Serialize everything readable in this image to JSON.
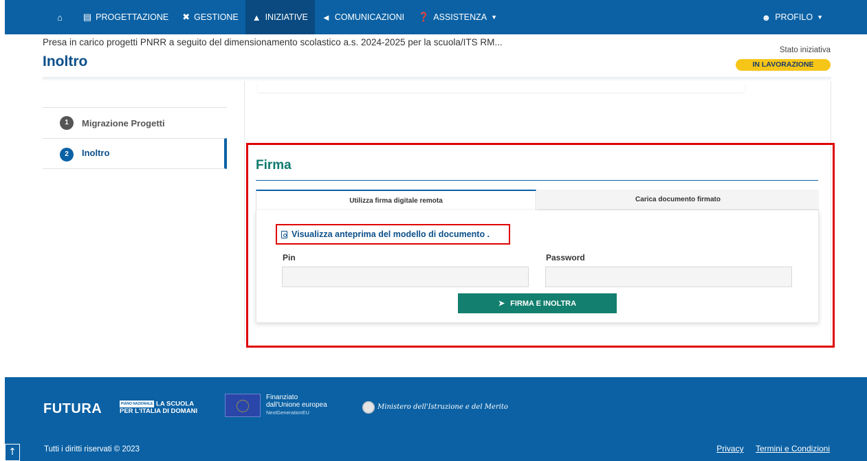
{
  "nav": {
    "items": [
      {
        "label": "PROGETTAZIONE",
        "icon": "clipboard-icon"
      },
      {
        "label": "GESTIONE",
        "icon": "tools-icon"
      },
      {
        "label": "INIZIATIVE",
        "icon": "rocket-icon"
      },
      {
        "label": "COMUNICAZIONI",
        "icon": "megaphone-icon"
      },
      {
        "label": "ASSISTENZA",
        "icon": "question-icon"
      }
    ],
    "profile": "PROFILO"
  },
  "header": {
    "subtitle": "Presa in carico progetti PNRR a seguito del dimensionamento scolastico a.s. 2024-2025 per la scuola/ITS RM...",
    "title": "Inoltro",
    "stato_label": "Stato iniziativa",
    "stato_value": "IN LAVORAZIONE"
  },
  "steps": [
    {
      "num": "1",
      "label": "Migrazione Progetti"
    },
    {
      "num": "2",
      "label": "Inoltro"
    }
  ],
  "firma": {
    "title": "Firma",
    "tabs": [
      "Utilizza firma digitale remota",
      "Carica documento firmato"
    ],
    "preview_link": "Visualizza anteprima del modello di documento",
    "pin_label": "Pin",
    "pin_value": "",
    "password_label": "Password",
    "password_value": "",
    "submit_label": "FIRMA E INOLTRA"
  },
  "footer": {
    "futura": "FUTURA",
    "futura_tag_small": "PIANO NAZIONALE",
    "futura_tag_1": "LA SCUOLA",
    "futura_tag_2": "PER L'ITALIA DI DOMANI",
    "eu_line1": "Finanziato",
    "eu_line2": "dall'Unione europea",
    "eu_line3": "NextGenerationEU",
    "ministero": "Ministero dell'Istruzione e del Merito",
    "copyright": "Tutti i diritti riservati © 2023",
    "link_privacy": "Privacy",
    "link_terms": "Termini e Condizioni"
  },
  "colors": {
    "brand_blue": "#0b61a4",
    "accent_green": "#137f6e",
    "status_yellow": "#f5c518",
    "highlight_red": "#e00000"
  }
}
